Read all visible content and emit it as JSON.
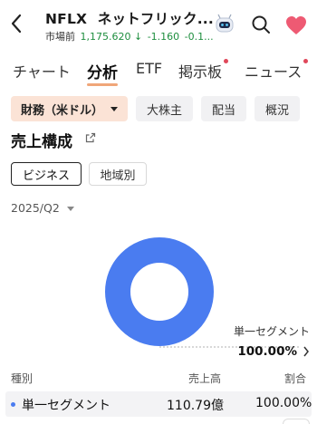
{
  "header": {
    "ticker": "NFLX",
    "company": "ネットフリック...",
    "session": "市場前",
    "price": "1,175.620",
    "change": "-1.160",
    "change_pct": "-0.1..."
  },
  "tabs": [
    {
      "label": "チャート",
      "active": false,
      "dot": false
    },
    {
      "label": "分析",
      "active": true,
      "dot": false
    },
    {
      "label": "ETF",
      "active": false,
      "dot": false
    },
    {
      "label": "掲示板",
      "active": false,
      "dot": true
    },
    {
      "label": "ニュース",
      "active": false,
      "dot": true
    }
  ],
  "chips": {
    "financials": "財務（米ドル）",
    "major_holders": "大株主",
    "dividend": "配当",
    "overview": "概況"
  },
  "section": {
    "title": "売上構成"
  },
  "segments": {
    "business": "ビジネス",
    "region": "地域別"
  },
  "period": "2025/Q2",
  "colors": {
    "accent": "#f0a679",
    "donut": "#4a7cf0",
    "up_down": "#1e8e3e",
    "heart": "#ee5a73"
  },
  "chart_data": {
    "type": "pie",
    "categories": [
      "単一セグメント"
    ],
    "values": [
      100.0
    ],
    "labels": [
      "100.00%"
    ]
  },
  "slice_label": {
    "name": "単一セグメント",
    "pct": "100.00%"
  },
  "table": {
    "headers": {
      "type": "種別",
      "revenue": "売上高",
      "ratio": "割合"
    },
    "rows": [
      {
        "name": "単一セグメント",
        "revenue": "110.79億",
        "ratio": "100.00%"
      }
    ]
  }
}
